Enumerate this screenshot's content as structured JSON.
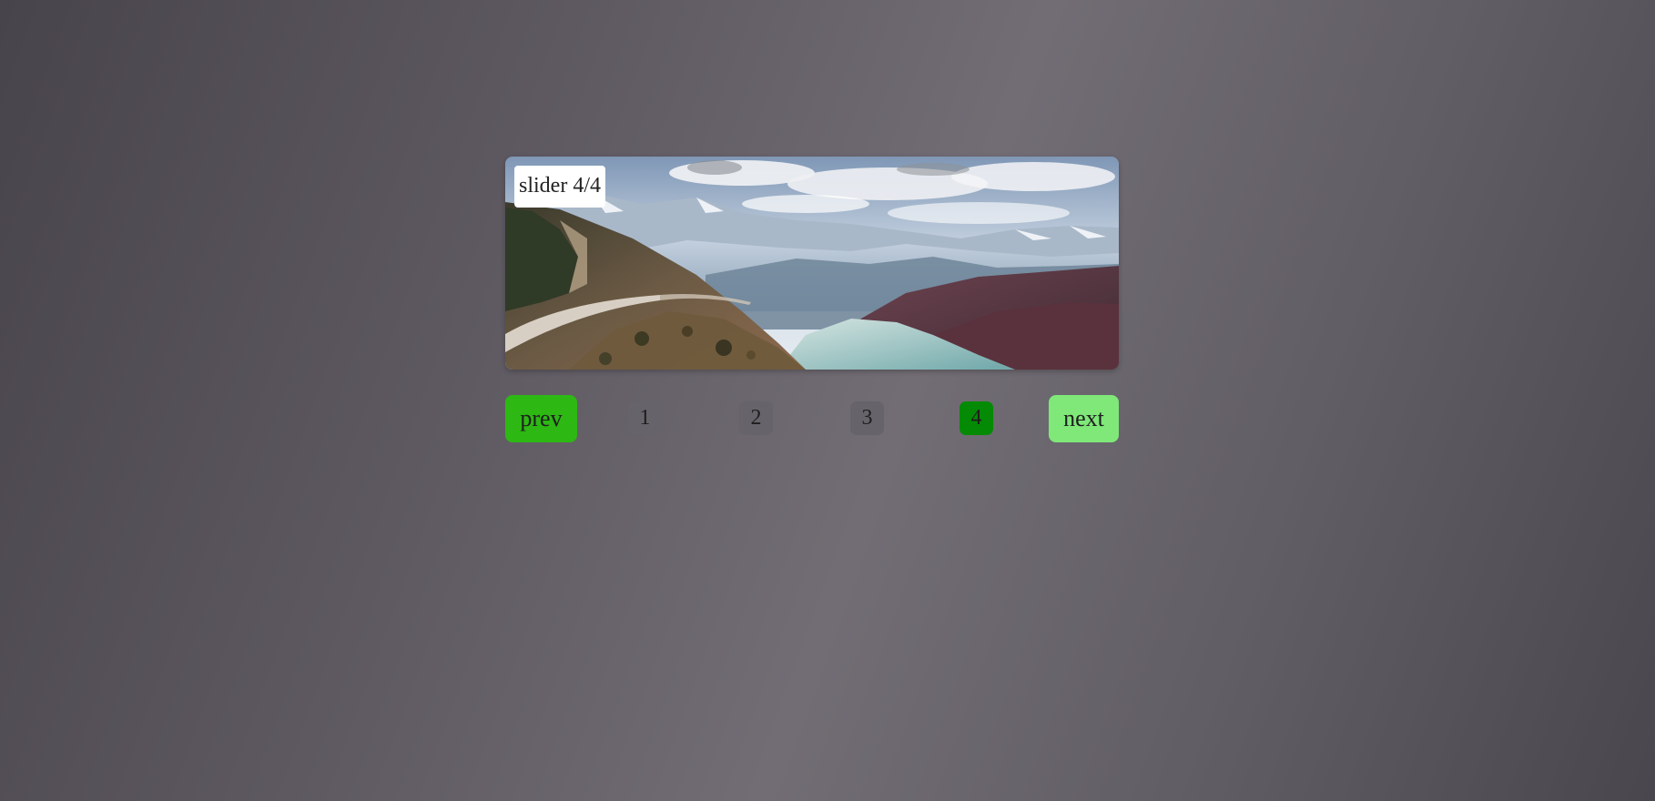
{
  "slider": {
    "caption": "slider 4/4",
    "image_alt": "mountain road above a turquoise lake"
  },
  "controls": {
    "prev_label": "prev",
    "next_label": "next",
    "pages": [
      "1",
      "2",
      "3",
      "4"
    ],
    "active_page": 4
  },
  "colors": {
    "prev_button": "#2db814",
    "next_button": "#7fe879",
    "active_dot": "#058a05",
    "inactive_dot": "#66636a",
    "caption_background": "#ffffff"
  }
}
